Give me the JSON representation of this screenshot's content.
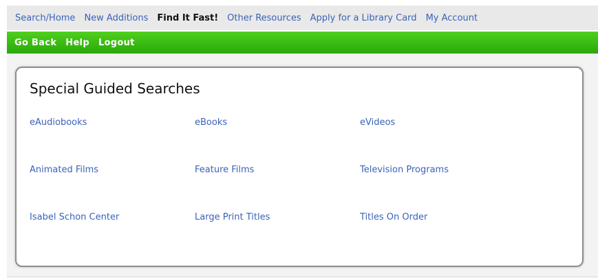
{
  "topnav": {
    "items": [
      {
        "label": "Search/Home"
      },
      {
        "label": "New Additions"
      },
      {
        "label": "Find It Fast!"
      },
      {
        "label": "Other Resources"
      },
      {
        "label": "Apply for a Library Card"
      },
      {
        "label": "My Account"
      }
    ],
    "active_index": 2
  },
  "actionbar": {
    "items": [
      {
        "label": "Go Back"
      },
      {
        "label": "Help"
      },
      {
        "label": "Logout"
      }
    ]
  },
  "panel": {
    "title": "Special Guided Searches",
    "rows": [
      [
        "eAudiobooks",
        "eBooks",
        "eVideos"
      ],
      [
        "Animated Films",
        "Feature Films",
        "Television Programs"
      ],
      [
        "Isabel Schon Center",
        "Large Print Titles",
        "Titles On Order"
      ]
    ]
  },
  "colors": {
    "link": "#3a62b8",
    "green_bar": "#2aa80a",
    "nav_bg": "#e9e9e9"
  }
}
